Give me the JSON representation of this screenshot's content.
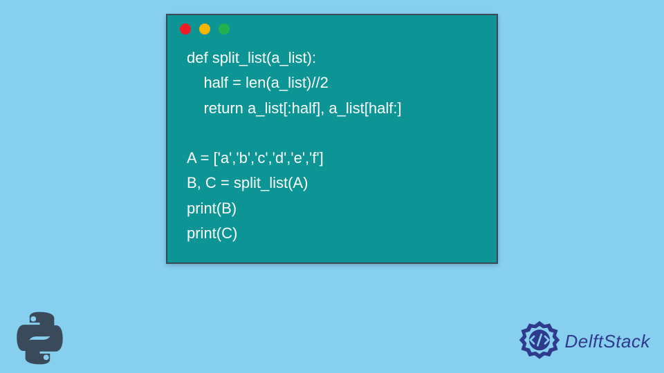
{
  "code": {
    "lines": [
      "def split_list(a_list):",
      "    half = len(a_list)//2",
      "    return a_list[:half], a_list[half:]",
      "",
      "A = ['a','b','c','d','e','f']",
      "B, C = split_list(A)",
      "print(B)",
      "print(C)"
    ]
  },
  "brand": {
    "name": "DelftStack"
  },
  "colors": {
    "bg": "#87cfef",
    "window": "#0d9596",
    "brand_text": "#2e3a8c"
  }
}
